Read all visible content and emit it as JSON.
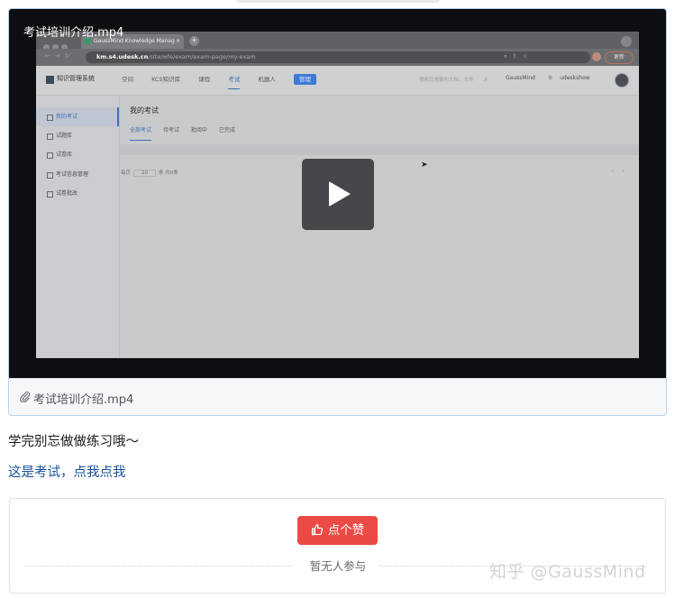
{
  "video": {
    "title": "考试培训介绍.mp4",
    "attachment_name": "考试培训介绍.mp4",
    "frame": {
      "browser_tab": "GaussMind Knowledge Manag",
      "url_host": "km.s4.udesk.cn",
      "url_path": "/site/wfe/exam/exam-page/my-exam",
      "update_label": "更新",
      "app_name": "知识管理系统",
      "nav": [
        "空间",
        "KCS知识库",
        "课程",
        "考试",
        "机器人"
      ],
      "nav_active": "考试",
      "nav_button": "管理",
      "search_placeholder": "搜索您想要的文档、文件",
      "workspace": "GaussMind",
      "user": "udeskshow",
      "sidebar": [
        "我的考试",
        "试题库",
        "试卷库",
        "考试信息管理",
        "试卷批改"
      ],
      "sidebar_selected": "我的考试",
      "page_title": "我的考试",
      "tabs": [
        "全部考试",
        "待考试",
        "批阅中",
        "已完成"
      ],
      "tab_selected": "全部考试",
      "pager_prefix": "每页",
      "pager_size": "20",
      "pager_unit": "条",
      "pager_total": "共0条"
    }
  },
  "article": {
    "paragraph": "学完别忘做做练习哦～",
    "link_text": "这是考试，点我点我"
  },
  "like": {
    "button_label": "点个赞",
    "status": "暂无人参与"
  },
  "watermark": "知乎 @GaussMind",
  "colors": {
    "link": "#175199",
    "like_button": "#eb4a45",
    "card_border": "#b9d2ec"
  }
}
